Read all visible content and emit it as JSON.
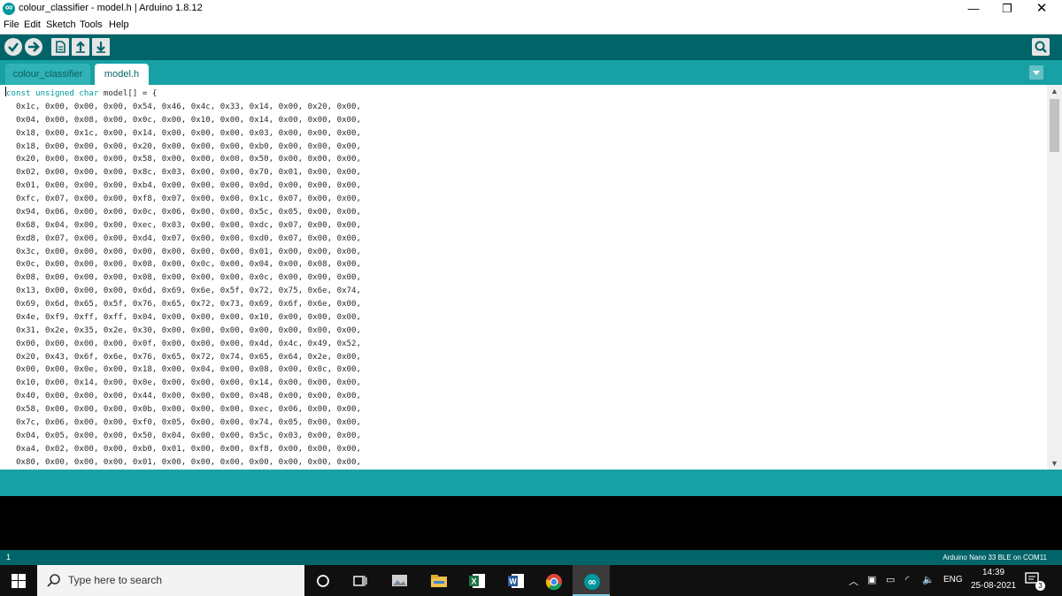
{
  "window": {
    "title": "colour_classifier - model.h | Arduino 1.8.12",
    "minimize_glyph": "—",
    "maximize_glyph": "❐",
    "close_glyph": "✕"
  },
  "menu": [
    "File",
    "Edit",
    "Sketch",
    "Tools",
    "Help"
  ],
  "toolbar": {
    "buttons": [
      "verify-icon",
      "upload-icon",
      "new-icon",
      "open-icon",
      "save-icon"
    ],
    "right_button": "serial-monitor-icon"
  },
  "tabs": [
    "colour_classifier",
    "model.h"
  ],
  "active_tab": "model.h",
  "editor": {
    "first_line_keywords": [
      "const",
      "unsigned",
      "char"
    ],
    "first_line_rest": " model[] = {",
    "lines": [
      "  0x1c, 0x00, 0x00, 0x00, 0x54, 0x46, 0x4c, 0x33, 0x14, 0x00, 0x20, 0x00,",
      "  0x04, 0x00, 0x08, 0x00, 0x0c, 0x00, 0x10, 0x00, 0x14, 0x00, 0x00, 0x00,",
      "  0x18, 0x00, 0x1c, 0x00, 0x14, 0x00, 0x00, 0x00, 0x03, 0x00, 0x00, 0x00,",
      "  0x18, 0x00, 0x00, 0x00, 0x20, 0x00, 0x00, 0x00, 0xb0, 0x00, 0x00, 0x00,",
      "  0x20, 0x00, 0x00, 0x00, 0x58, 0x00, 0x00, 0x00, 0x50, 0x00, 0x00, 0x00,",
      "  0x02, 0x00, 0x00, 0x00, 0x8c, 0x03, 0x00, 0x00, 0x70, 0x01, 0x00, 0x00,",
      "  0x01, 0x00, 0x00, 0x00, 0xb4, 0x00, 0x00, 0x00, 0x0d, 0x00, 0x00, 0x00,",
      "  0xfc, 0x07, 0x00, 0x00, 0xf8, 0x07, 0x00, 0x00, 0x1c, 0x07, 0x00, 0x00,",
      "  0x94, 0x06, 0x00, 0x00, 0x0c, 0x06, 0x00, 0x00, 0x5c, 0x05, 0x00, 0x00,",
      "  0x68, 0x04, 0x00, 0x00, 0xec, 0x03, 0x00, 0x00, 0xdc, 0x07, 0x00, 0x00,",
      "  0xd8, 0x07, 0x00, 0x00, 0xd4, 0x07, 0x00, 0x00, 0xd0, 0x07, 0x00, 0x00,",
      "  0x3c, 0x00, 0x00, 0x00, 0x00, 0x00, 0x00, 0x00, 0x01, 0x00, 0x00, 0x00,",
      "  0x0c, 0x00, 0x00, 0x00, 0x08, 0x00, 0x0c, 0x00, 0x04, 0x00, 0x08, 0x00,",
      "  0x08, 0x00, 0x00, 0x00, 0x08, 0x00, 0x00, 0x00, 0x0c, 0x00, 0x00, 0x00,",
      "  0x13, 0x00, 0x00, 0x00, 0x6d, 0x69, 0x6e, 0x5f, 0x72, 0x75, 0x6e, 0x74,",
      "  0x69, 0x6d, 0x65, 0x5f, 0x76, 0x65, 0x72, 0x73, 0x69, 0x6f, 0x6e, 0x00,",
      "  0x4e, 0xf9, 0xff, 0xff, 0x04, 0x00, 0x00, 0x00, 0x10, 0x00, 0x00, 0x00,",
      "  0x31, 0x2e, 0x35, 0x2e, 0x30, 0x00, 0x00, 0x00, 0x00, 0x00, 0x00, 0x00,",
      "  0x00, 0x00, 0x00, 0x00, 0x0f, 0x00, 0x00, 0x00, 0x4d, 0x4c, 0x49, 0x52,",
      "  0x20, 0x43, 0x6f, 0x6e, 0x76, 0x65, 0x72, 0x74, 0x65, 0x64, 0x2e, 0x00,",
      "  0x00, 0x00, 0x0e, 0x00, 0x18, 0x00, 0x04, 0x00, 0x08, 0x00, 0x0c, 0x00,",
      "  0x10, 0x00, 0x14, 0x00, 0x0e, 0x00, 0x00, 0x00, 0x14, 0x00, 0x00, 0x00,",
      "  0x40, 0x00, 0x00, 0x00, 0x44, 0x00, 0x00, 0x00, 0x48, 0x00, 0x00, 0x00,",
      "  0x58, 0x00, 0x00, 0x00, 0x0b, 0x00, 0x00, 0x00, 0xec, 0x06, 0x00, 0x00,",
      "  0x7c, 0x06, 0x00, 0x00, 0xf0, 0x05, 0x00, 0x00, 0x74, 0x05, 0x00, 0x00,",
      "  0x04, 0x05, 0x00, 0x00, 0x50, 0x04, 0x00, 0x00, 0x5c, 0x03, 0x00, 0x00,",
      "  0xa4, 0x02, 0x00, 0x00, 0xb0, 0x01, 0x00, 0x00, 0xf8, 0x00, 0x00, 0x00,",
      "  0x80, 0x00, 0x00, 0x00, 0x01, 0x00, 0x00, 0x00, 0x00, 0x00, 0x00, 0x00,"
    ]
  },
  "footer": {
    "line_number": "1",
    "board": "Arduino Nano 33 BLE on COM11"
  },
  "taskbar": {
    "search_placeholder": "Type here to search",
    "apps": [
      "cortana-icon",
      "task-view-icon",
      "photos-icon",
      "file-explorer-icon",
      "excel-icon",
      "word-icon",
      "chrome-icon",
      "arduino-icon"
    ],
    "language": "ENG",
    "time": "14:39",
    "date": "25-08-2021",
    "notification_count": "3"
  },
  "colors": {
    "toolbar": "#006468",
    "tabbar": "#17a1a5",
    "keyword": "#00979c",
    "console": "#000000"
  }
}
